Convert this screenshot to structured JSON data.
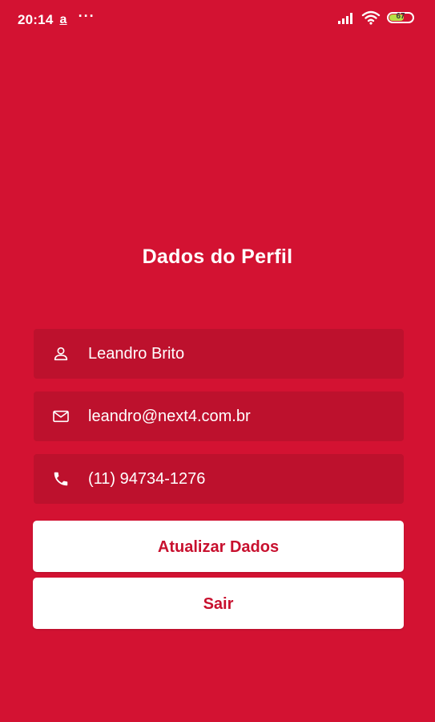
{
  "status_bar": {
    "time": "20:14",
    "notification_icon": "a",
    "more_indicator": "···",
    "battery_level": "67",
    "battery_fraction": 0.67,
    "battery_color": "#b7e046"
  },
  "page": {
    "title": "Dados do Perfil",
    "background_color": "#d31232",
    "field_color": "#bd112d",
    "button_text_color": "#c8102e"
  },
  "profile": {
    "name": "Leandro Brito",
    "name_icon": "person-icon",
    "email": "leandro@next4.com.br",
    "email_icon": "mail-icon",
    "phone": "(11) 94734-1276",
    "phone_icon": "phone-icon"
  },
  "actions": {
    "update_label": "Atualizar Dados",
    "logout_label": "Sair"
  }
}
